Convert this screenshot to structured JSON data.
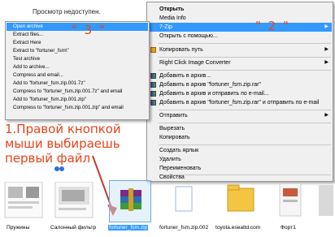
{
  "preview_text": "Просмотр недоступен.",
  "main_menu": {
    "items": [
      {
        "label": "Открыть",
        "bold": true
      },
      {
        "label": "Media Info"
      },
      {
        "label": "7-Zip",
        "highlight": true,
        "submenu": true
      },
      {
        "label": "Открыть с помощью..."
      },
      {
        "label": "Копировать путь",
        "submenu": true,
        "icon": "copy-path-icon"
      },
      {
        "label": "Right Click Image Converter",
        "submenu": true
      },
      {
        "label": "Добавить в архив...",
        "icon": "winrar-icon"
      },
      {
        "label": "Добавить в архив \"fortuner_fsm.zip.rar\"",
        "icon": "winrar-icon"
      },
      {
        "label": "Добавить в архив и отправить по e-mail...",
        "icon": "winrar-icon"
      },
      {
        "label": "Добавить в архив \"fortuner_fsm.zip.rar\" и отправить по e-mail",
        "icon": "winrar-icon"
      },
      {
        "label": "Отправить",
        "submenu": true
      },
      {
        "label": "Вырезать"
      },
      {
        "label": "Копировать"
      },
      {
        "label": "Создать ярлык"
      },
      {
        "label": "Удалить"
      },
      {
        "label": "Переименовать"
      },
      {
        "label": "Свойства"
      }
    ]
  },
  "zip_menu": {
    "items": [
      {
        "label": "Open archive",
        "highlight": true
      },
      {
        "label": "Extract files..."
      },
      {
        "label": "Extract Here"
      },
      {
        "label": "Extract to \"fortuner_fsm\\\""
      },
      {
        "label": "Test archive"
      },
      {
        "label": "Add to archive..."
      },
      {
        "label": "Compress and email..."
      },
      {
        "label": "Add to \"fortuner_fsm.zip.001.7z\""
      },
      {
        "label": "Compress to \"fortuner_fsm.zip.001.7z\" and email"
      },
      {
        "label": "Add to \"fortuner_fsm.zip.001.zip\""
      },
      {
        "label": "Compress to \"fortuner_fsm.zip.001.zip\" and email"
      }
    ]
  },
  "annotations": {
    "label_2": "\" 2 \"",
    "label_3": "\" 3 \"",
    "instruction": "1.Правой кнопкой мыши выбираешь первый файл"
  },
  "files": [
    {
      "name": "Пружины"
    },
    {
      "name": "Салонный фильтр"
    },
    {
      "name": "fortuner_fsm.zip",
      "selected": true
    },
    {
      "name": "fortuner_fsm.zip.002"
    },
    {
      "name": "toyota.esealtd.com"
    },
    {
      "name": "Форт1"
    }
  ],
  "colors": {
    "highlight": "#3399ff",
    "annotation": "#e8431a"
  }
}
